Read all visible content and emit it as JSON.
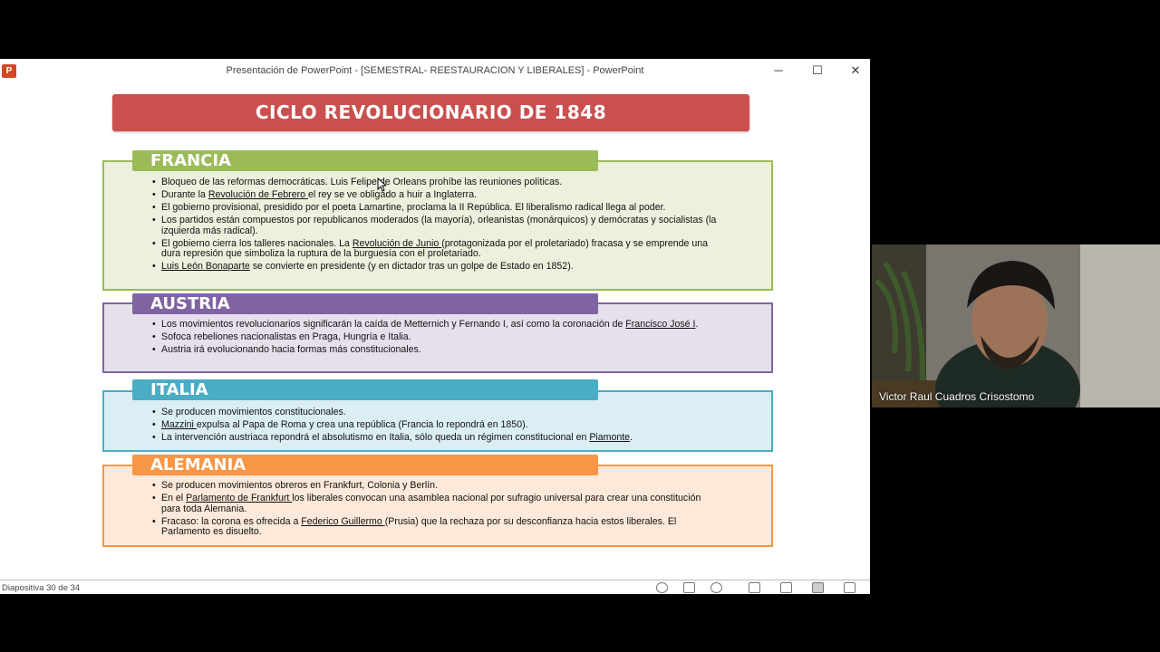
{
  "window": {
    "title": "Presentación de PowerPoint - [SEMESTRAL- REESTAURACION Y LIBERALES] - PowerPoint",
    "app_icon": "P",
    "controls": {
      "minimize": "─",
      "maximize": "☐",
      "close": "✕"
    }
  },
  "slide": {
    "banner": "CICLO REVOLUCIONARIO DE 1848",
    "sections": [
      {
        "title": "FRANCIA",
        "items": [
          [
            "Bloqueo de las reformas democráticas. Luis Felipe de Orleans prohíbe las reuniones políticas."
          ],
          [
            "Durante la ",
            "Revolución de Febrero ",
            "el rey se ve obligado a huir a Inglaterra."
          ],
          [
            "El gobierno provisional, presidido por el poeta Lamartine, proclama la II República. El liberalismo radical llega al poder."
          ],
          [
            "Los partidos están compuestos por republicanos moderados (la mayoría), orleanistas (monárquicos) y demócratas y socialistas (la izquierda más radical)."
          ],
          [
            "El gobierno cierra los talleres nacionales.  La ",
            "Revolución de Junio ",
            "(protagonizada por el proletariado) fracasa y se emprende una dura represión que simboliza la ruptura de la burguesía con el proletariado."
          ],
          [
            "",
            "Luis León Bonaparte",
            " se convierte en presidente (y en dictador tras un golpe de Estado en 1852)."
          ]
        ]
      },
      {
        "title": "AUSTRIA",
        "items": [
          [
            "Los movimientos revolucionarios significarán la caída de Metternich y Fernando I, así como la coronación de ",
            "Francisco José I",
            "."
          ],
          [
            "Sofoca rebeliones nacionalistas en Praga, Hungría e Italia."
          ],
          [
            "Austria irá evolucionando hacia formas más constitucionales."
          ]
        ]
      },
      {
        "title": "ITALIA",
        "items": [
          [
            "Se producen movimientos constitucionales."
          ],
          [
            "",
            "Mazzini ",
            "expulsa al Papa de Roma y crea una república (Francia lo repondrá en 1850)."
          ],
          [
            "La intervención austriaca  repondrá el absolutismo en Italia,  sólo  queda un régimen constitucional en ",
            "Piamonte",
            "."
          ]
        ]
      },
      {
        "title": "ALEMANIA",
        "items": [
          [
            "Se producen movimientos obreros en Frankfurt, Colonia y Berlín."
          ],
          [
            "En el ",
            "Parlamento de Frankfurt ",
            "los liberales convocan una asamblea nacional por sufragio universal para crear una constitución para toda Alemania."
          ],
          [
            "Fracaso: la corona es ofrecida a ",
            "Federico Guillermo ",
            "(Prusia) que la rechaza por su desconfianza hacia estos liberales. El Parlamento es disuelto."
          ]
        ]
      }
    ]
  },
  "statusbar": {
    "slide_counter": "Diapositiva 30 de 34",
    "icons": [
      "accessibility-icon",
      "notes-icon",
      "comments-icon",
      "normal-view-icon",
      "slide-sorter-icon",
      "reading-view-icon",
      "slideshow-icon"
    ]
  },
  "video": {
    "participant_name": "Victor Raul Cuadros Crisostomo"
  },
  "colors": {
    "banner": "#c9504e",
    "francia": "#9bbb59",
    "austria": "#8064a2",
    "italia": "#4bacc6",
    "alemania": "#f79646"
  }
}
